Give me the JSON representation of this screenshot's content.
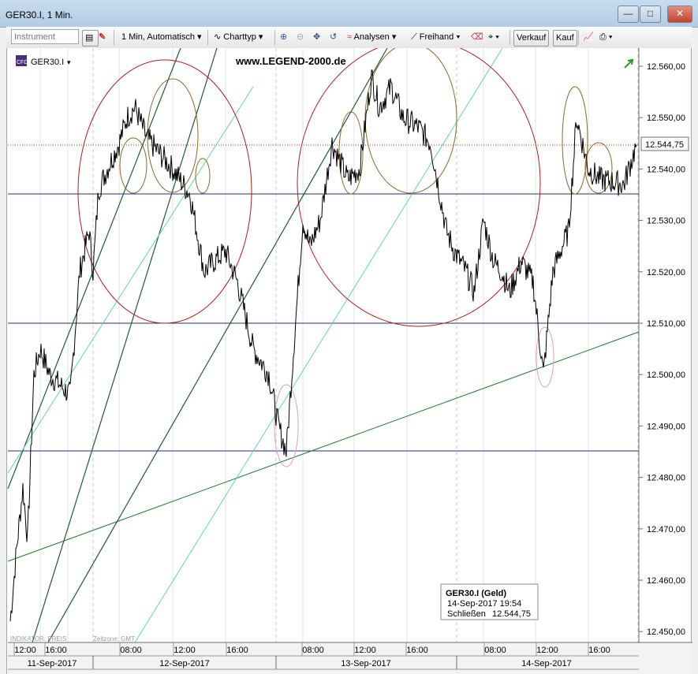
{
  "window": {
    "title": "GER30.I, 1 Min."
  },
  "toolbar": {
    "instrument_placeholder": "Instrument",
    "interval_label": "1 Min, Automatisch",
    "charttype_label": "Charttyp",
    "analyses_label": "Analysen",
    "freehand_label": "Freihand",
    "sell_label": "Verkauf",
    "buy_label": "Kauf",
    "icons": [
      "instrument-list-icon",
      "compare-icon",
      "line-chart-icon",
      "zoom-in-icon",
      "zoom-out-icon",
      "move-icon",
      "undo-icon",
      "analyses-icon",
      "freehand-icon",
      "eraser-icon",
      "crosshair-icon",
      "chart-icon",
      "print-icon"
    ]
  },
  "chart": {
    "symbol": "GER30.I",
    "watermark": "www.LEGEND-2000.de",
    "indicator_note": "INDIKATOR: PREIS",
    "timezone_note": "Zeitzone: GMT",
    "tooltip": {
      "title": "GER30.I (Geld)",
      "date": "14-Sep-2017 19:54",
      "label": "Schließen",
      "value": "12.544,75"
    },
    "current_price_label": "12.544,75",
    "y_ticks": [
      "12.560,00",
      "12.550,00",
      "12.540,00",
      "12.530,00",
      "12.520,00",
      "12.510,00",
      "12.500,00",
      "12.490,00",
      "12.480,00",
      "12.470,00",
      "12.460,00",
      "12.450,00"
    ],
    "time_ticks": [
      "12:00",
      "16:00",
      "08:00",
      "12:00",
      "16:00",
      "08:00",
      "12:00",
      "16:00",
      "08:00",
      "12:00",
      "16:00"
    ],
    "date_ticks": [
      "11-Sep-2017",
      "12-Sep-2017",
      "13-Sep-2017",
      "14-Sep-2017"
    ],
    "colors": {
      "price": "#000000",
      "hline": "#2a2a7a",
      "support": "#1d7a2c",
      "channel": "#1f5a36",
      "lightline": "#62d6a3",
      "big_circle": "#b31b1b",
      "small_ellipse": "#8a6a2a",
      "low_ellipse": "#e0a0b0",
      "dotted": "#8b3a1a"
    }
  },
  "chart_data": {
    "type": "line",
    "title": "GER30.I, 1 Min.",
    "xlabel": "",
    "ylabel": "",
    "ylim": [
      12448,
      12563
    ],
    "series": [
      {
        "name": "GER30.I",
        "x": [
          "11-Sep-2017 10:00",
          "11-Sep-2017 11:00",
          "11-Sep-2017 12:00",
          "11-Sep-2017 13:00",
          "11-Sep-2017 14:00",
          "11-Sep-2017 15:00",
          "11-Sep-2017 16:00",
          "11-Sep-2017 17:00",
          "11-Sep-2017 18:00",
          "11-Sep-2017 19:00",
          "11-Sep-2017 20:00",
          "11-Sep-2017 21:00",
          "12-Sep-2017 06:00",
          "12-Sep-2017 07:00",
          "12-Sep-2017 08:00",
          "12-Sep-2017 09:00",
          "12-Sep-2017 10:00",
          "12-Sep-2017 11:00",
          "12-Sep-2017 12:00",
          "12-Sep-2017 13:00",
          "12-Sep-2017 14:00",
          "12-Sep-2017 15:00",
          "12-Sep-2017 16:00",
          "12-Sep-2017 17:00",
          "12-Sep-2017 18:00",
          "12-Sep-2017 19:00",
          "12-Sep-2017 20:00",
          "12-Sep-2017 21:00",
          "13-Sep-2017 06:00",
          "13-Sep-2017 07:00",
          "13-Sep-2017 08:00",
          "13-Sep-2017 09:00",
          "13-Sep-2017 10:00",
          "13-Sep-2017 11:00",
          "13-Sep-2017 12:00",
          "13-Sep-2017 13:00",
          "13-Sep-2017 14:00",
          "13-Sep-2017 15:00",
          "13-Sep-2017 16:00",
          "13-Sep-2017 17:00",
          "13-Sep-2017 18:00",
          "13-Sep-2017 19:00",
          "13-Sep-2017 20:00",
          "13-Sep-2017 21:00",
          "14-Sep-2017 06:00",
          "14-Sep-2017 07:00",
          "14-Sep-2017 08:00",
          "14-Sep-2017 09:00",
          "14-Sep-2017 10:00",
          "14-Sep-2017 11:00",
          "14-Sep-2017 12:00",
          "14-Sep-2017 13:00",
          "14-Sep-2017 14:00",
          "14-Sep-2017 15:00",
          "14-Sep-2017 16:00",
          "14-Sep-2017 17:00",
          "14-Sep-2017 18:00",
          "14-Sep-2017 19:00",
          "14-Sep-2017 19:54"
        ],
        "values": [
          12452,
          12466,
          12478,
          12468,
          12500,
          12505,
          12500,
          12498,
          12496,
          12520,
          12528,
          12520,
          12536,
          12540,
          12545,
          12550,
          12552,
          12546,
          12540,
          12535,
          12520,
          12522,
          12524,
          12518,
          12505,
          12500,
          12490,
          12485,
          12530,
          12525,
          12530,
          12545,
          12538,
          12540,
          12558,
          12552,
          12556,
          12550,
          12548,
          12545,
          12528,
          12524,
          12520,
          12516,
          12530,
          12522,
          12520,
          12516,
          12522,
          12518,
          12500,
          12520,
          12525,
          12528,
          12550,
          12540,
          12538,
          12537,
          12544.75
        ]
      }
    ],
    "grid": true
  }
}
